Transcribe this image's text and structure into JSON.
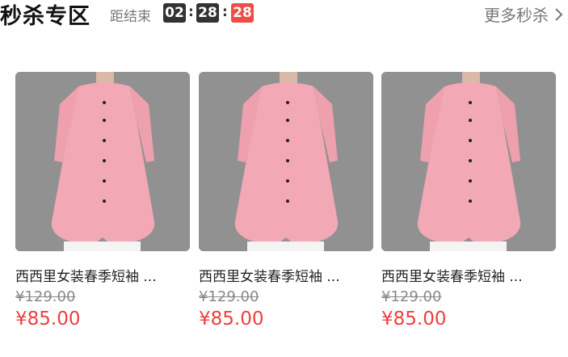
{
  "header": {
    "title": "秒杀专区",
    "countdown_label": "距结束",
    "countdown": {
      "hours": "02",
      "minutes": "28",
      "seconds": "28",
      "separator": ":"
    },
    "more_label": "更多秒杀",
    "more_icon": "chevron-right-icon"
  },
  "products": [
    {
      "name": "西西里女装春季短袖 ...",
      "original_price": "¥129.00",
      "price": "¥85.00"
    },
    {
      "name": "西西里女装春季短袖 ...",
      "original_price": "¥129.00",
      "price": "¥85.00"
    },
    {
      "name": "西西里女装春季短袖 ...",
      "original_price": "¥129.00",
      "price": "¥85.00"
    }
  ],
  "colors": {
    "accent_red": "#ef3e3e",
    "timer_dark": "#333333",
    "product_pink": "#f2a8b5"
  }
}
